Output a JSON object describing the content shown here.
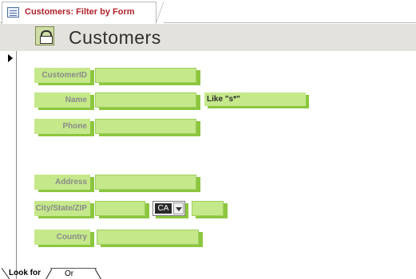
{
  "document_tab": {
    "title": "Customers: Filter by Form",
    "icon": "form-icon"
  },
  "header": {
    "title": "Customers",
    "icon": "form-filter-icon"
  },
  "fields": {
    "customer_id": {
      "label": "CustomerID",
      "value": ""
    },
    "name": {
      "label": "Name",
      "value": "",
      "criteria": "Like \"s*\""
    },
    "phone": {
      "label": "Phone",
      "value": ""
    },
    "address": {
      "label": "Address",
      "value": ""
    },
    "city_state_zip": {
      "label": "City/State/ZIP",
      "city": "",
      "state": "CA",
      "zip": ""
    },
    "country": {
      "label": "Country",
      "value": ""
    }
  },
  "bottom_tabs": {
    "look_for": "Look for",
    "or": "Or"
  },
  "colors": {
    "label_bg": "#c5e88b",
    "shadow": "#8cc63f",
    "title_red": "#b0222b",
    "header_bg": "#e4e2dc"
  }
}
